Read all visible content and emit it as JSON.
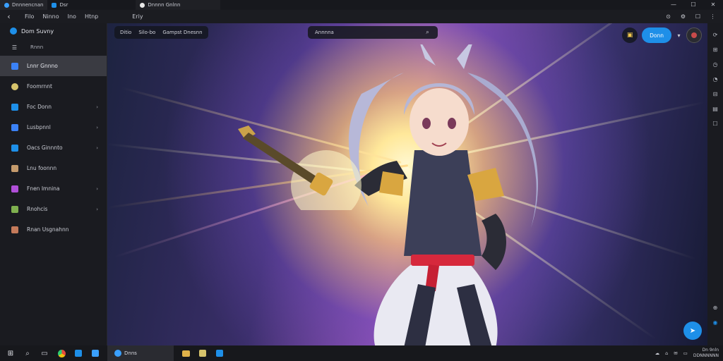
{
  "titlebar": {
    "tabs": [
      {
        "label": "Dnnnencnan",
        "color": "#3aa0ff"
      },
      {
        "label": "Dsr",
        "color": "#1e8fe8"
      },
      {
        "label": "Dnnnn Gnlnn",
        "color": "#e8e8e8"
      }
    ],
    "controls": [
      "—",
      "☐",
      "✕"
    ]
  },
  "menubar": {
    "back": "‹",
    "items": [
      "Filo",
      "Ninno",
      "Ino",
      "Htnp",
      "Eriy"
    ],
    "right_icons": [
      "⊙",
      "⚙",
      "☐",
      "⋮"
    ]
  },
  "sidebar": {
    "header": "Dom Suvny",
    "sub_label": "Rnnn",
    "items": [
      {
        "label": "Lnnr Gnnno",
        "color": "#3b82f6",
        "active": true,
        "chevron": false
      },
      {
        "label": "Foomrnnt",
        "color": "#d6c36b",
        "active": false,
        "chevron": false
      },
      {
        "label": "Foc Donn",
        "color": "#1e8fe8",
        "active": false,
        "chevron": true
      },
      {
        "label": "Lusbpnnl",
        "color": "#3b82f6",
        "active": false,
        "chevron": true
      },
      {
        "label": "Oacs Ginnnto",
        "color": "#1e8fe8",
        "active": false,
        "chevron": true
      },
      {
        "label": "Lnu foonnn",
        "color": "#c49a6c",
        "active": false,
        "chevron": false
      },
      {
        "label": "Fnen Imnina",
        "color": "#b04fd8",
        "active": false,
        "chevron": true
      },
      {
        "label": "Rnohcis",
        "color": "#7fb04f",
        "active": false,
        "chevron": true
      },
      {
        "label": "Rnan Usgnahnn",
        "color": "#c47a5a",
        "active": false,
        "chevron": false
      }
    ]
  },
  "main": {
    "breadcrumb": [
      "Ditio",
      "Silo-bo",
      "Gampst Dnesnn"
    ],
    "search_placeholder": "Annnna",
    "action_button": "Donn",
    "colors": {
      "accent": "#1e8fe8"
    }
  },
  "rail": {
    "icons": [
      "⟳",
      "⊞",
      "◷",
      "◔",
      "⊟",
      "▤",
      "☐"
    ],
    "lower_icons": [
      "⊕",
      "◉"
    ]
  },
  "taskbar": {
    "active_app": "Dnns",
    "tray_icons": [
      "☁",
      "⌂",
      "✉",
      "▭"
    ],
    "time": "Dn 9nln",
    "date": "DDNNNNNN"
  }
}
